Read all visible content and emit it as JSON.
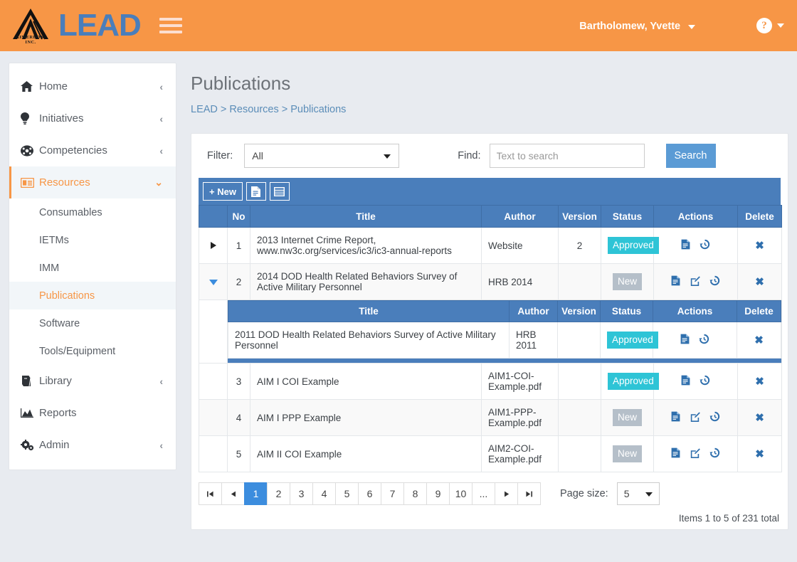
{
  "header": {
    "logo_text": "LEAD",
    "logo_sub": "AIMEREON, INC.",
    "username": "Bartholomew, Yvette",
    "help_glyph": "?",
    "menu_icon": "hamburger-icon"
  },
  "sidebar": {
    "items": [
      {
        "label": "Home",
        "icon": "home-icon",
        "chevron": "‹",
        "active": false
      },
      {
        "label": "Initiatives",
        "icon": "lightbulb-icon",
        "chevron": "‹",
        "active": false
      },
      {
        "label": "Competencies",
        "icon": "wheel-icon",
        "chevron": "‹",
        "active": false
      },
      {
        "label": "Resources",
        "icon": "id-card-icon",
        "chevron": "⌄",
        "active": true
      },
      {
        "label": "Library",
        "icon": "book-icon",
        "chevron": "‹",
        "active": false
      },
      {
        "label": "Reports",
        "icon": "chart-area-icon",
        "chevron": "",
        "active": false
      },
      {
        "label": "Admin",
        "icon": "gears-icon",
        "chevron": "‹",
        "active": false
      }
    ],
    "sub_items": [
      {
        "label": "Consumables",
        "active": false
      },
      {
        "label": "IETMs",
        "active": false
      },
      {
        "label": "IMM",
        "active": false
      },
      {
        "label": "Publications",
        "active": true
      },
      {
        "label": "Software",
        "active": false
      },
      {
        "label": "Tools/Equipment",
        "active": false
      }
    ]
  },
  "page": {
    "title": "Publications",
    "breadcrumb": [
      "LEAD",
      "Resources",
      "Publications"
    ],
    "breadcrumb_text": "LEAD > Resources > Publications"
  },
  "filter_bar": {
    "filter_label": "Filter:",
    "filter_value": "All",
    "find_label": "Find:",
    "find_value": "",
    "find_placeholder": "Text to search",
    "search_button": "Search"
  },
  "grid_toolbar": {
    "new_label": "+ New",
    "export_doc_icon": "document-icon",
    "export_grid_icon": "table-icon"
  },
  "table": {
    "columns": [
      "",
      "No",
      "Title",
      "Author",
      "Version",
      "Status",
      "Actions",
      "Delete"
    ],
    "rows": [
      {
        "expander": "collapsed",
        "no": "1",
        "title": "2013 Internet Crime Report, www.nw3c.org/services/ic3/ic3-annual-reports",
        "title_line1": "2013 Internet Crime Report,",
        "title_line2": "www.nw3c.org/services/ic3/ic3-annual-reports",
        "author": "Website",
        "version": "2",
        "status": "Approved",
        "status_kind": "approved",
        "actions": [
          "document-icon",
          "history-icon"
        ],
        "delete": "✖"
      },
      {
        "expander": "expanded",
        "no": "2",
        "title": "2014 DOD Health Related Behaviors Survey of Active Military Personnel",
        "author": "HRB 2014",
        "version": "",
        "status": "New",
        "status_kind": "new",
        "actions": [
          "document-icon",
          "edit-icon",
          "history-icon"
        ],
        "delete": "✖"
      },
      {
        "expander": "",
        "no": "3",
        "title": "AIM I COI Example",
        "author": "AIM1-COI-Example.pdf",
        "version": "",
        "status": "Approved",
        "status_kind": "approved",
        "actions": [
          "document-icon",
          "history-icon"
        ],
        "delete": "✖"
      },
      {
        "expander": "",
        "no": "4",
        "title": "AIM I PPP Example",
        "author": "AIM1-PPP-Example.pdf",
        "version": "",
        "status": "New",
        "status_kind": "new",
        "actions": [
          "document-icon",
          "edit-icon",
          "history-icon"
        ],
        "delete": "✖"
      },
      {
        "expander": "",
        "no": "5",
        "title": "AIM II COI Example",
        "author": "AIM2-COI-Example.pdf",
        "version": "",
        "status": "New",
        "status_kind": "new",
        "actions": [
          "document-icon",
          "edit-icon",
          "history-icon"
        ],
        "delete": "✖"
      }
    ],
    "detail": {
      "columns": [
        "Title",
        "Author",
        "Version",
        "Status",
        "Actions",
        "Delete"
      ],
      "rows": [
        {
          "title": "2011 DOD Health Related Behaviors Survey of Active Military Personnel",
          "author": "HRB 2011",
          "version": "",
          "status": "Approved",
          "status_kind": "approved",
          "actions": [
            "document-icon",
            "history-icon"
          ],
          "delete": "✖"
        }
      ]
    }
  },
  "pager": {
    "first": "⏮",
    "prev": "◀",
    "pages": [
      "1",
      "2",
      "3",
      "4",
      "5",
      "6",
      "7",
      "8",
      "9",
      "10",
      "..."
    ],
    "active_page": "1",
    "next": "▶",
    "last": "⏭",
    "page_size_label": "Page size:",
    "page_size_value": "5",
    "items_total": "Items 1 to 5 of 231 total"
  },
  "colors": {
    "header_orange": "#f79646",
    "brand_blue": "#4a7ebb",
    "accent_blue": "#3c8dde",
    "approved_teal": "#2ec4d6",
    "new_gray": "#b5bfc9",
    "page_bg": "#e8ebf0"
  }
}
